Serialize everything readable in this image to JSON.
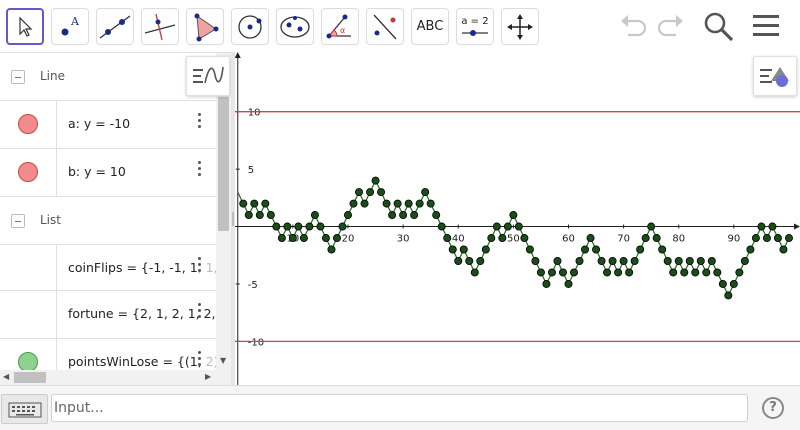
{
  "toolbar": {
    "tools": [
      {
        "name": "move-tool",
        "icon": "arrow-cursor-icon",
        "selected": true
      },
      {
        "name": "point-tool",
        "icon": "point-icon"
      },
      {
        "name": "line-tool",
        "icon": "line-icon"
      },
      {
        "name": "perpendicular-line-tool",
        "icon": "perpendicular-line-icon"
      },
      {
        "name": "polygon-tool",
        "icon": "polygon-icon"
      },
      {
        "name": "circle-center-point-tool",
        "icon": "circle-icon"
      },
      {
        "name": "conic-tool",
        "icon": "ellipse-icon"
      },
      {
        "name": "angle-tool",
        "icon": "angle-icon"
      },
      {
        "name": "reflect-tool",
        "icon": "reflect-icon"
      },
      {
        "name": "text-tool",
        "icon": "text-icon",
        "label": "ABC"
      },
      {
        "name": "slider-tool",
        "icon": "slider-icon",
        "label": "a = 2"
      },
      {
        "name": "move-graphics-view-tool",
        "icon": "move-view-icon"
      }
    ],
    "right_icons": [
      "undo-icon",
      "redo-icon",
      "search-icon",
      "menu-icon"
    ]
  },
  "algebra": {
    "groups": [
      {
        "label": "Line",
        "rows": [
          {
            "expr": "a: y = -10",
            "color": "#f28b8b",
            "visible": true
          },
          {
            "expr": "b: y = 10",
            "color": "#f28b8b",
            "visible": true
          }
        ]
      },
      {
        "label": "List",
        "rows": [
          {
            "expr": "coinFlips = {-1, -1, 1, 1,",
            "visible": false
          },
          {
            "expr": "fortune = {2, 1, 2, 1, 2, 1",
            "visible": false
          },
          {
            "expr": "pointsWinLose = {(1, 2),",
            "color": "#8fd18f",
            "visible": true
          }
        ]
      }
    ]
  },
  "input": {
    "placeholder": "Input..."
  },
  "colors": {
    "accent": "#6557d2",
    "line": "#cc4444",
    "points": "#1a4d1a",
    "segments": "#1f6b1f"
  },
  "chart_data": {
    "type": "line",
    "x_ticks": [
      10,
      20,
      30,
      40,
      50,
      60,
      70,
      80,
      90
    ],
    "y_ticks": [
      -10,
      -5,
      5,
      10
    ],
    "x_origin_label": "0",
    "xlim": [
      -0.5,
      102
    ],
    "ylim": [
      -13.8,
      15.2
    ],
    "horizontal_lines": [
      {
        "name": "a",
        "y": -10
      },
      {
        "name": "b",
        "y": 10
      }
    ],
    "series": [
      {
        "x": [
          1,
          2,
          3,
          4,
          5,
          6,
          7,
          8,
          9,
          10,
          11,
          12,
          13,
          14,
          15,
          16,
          17,
          18,
          19,
          20,
          21,
          22,
          23,
          24,
          25,
          26,
          27,
          28,
          29,
          30,
          31,
          32,
          33,
          34,
          35,
          36,
          37,
          38,
          39,
          40,
          41,
          42,
          43,
          44,
          45,
          46,
          47,
          48,
          49,
          50,
          51,
          52,
          53,
          54,
          55,
          56,
          57,
          58,
          59,
          60,
          61,
          62,
          63,
          64,
          65,
          66,
          67,
          68,
          69,
          70,
          71,
          72,
          73,
          74,
          75,
          76,
          77,
          78,
          79,
          80,
          81,
          82,
          83,
          84,
          85,
          86,
          87,
          88,
          89,
          90,
          91,
          92,
          93,
          94,
          95,
          96,
          97,
          98,
          99,
          100
        ],
        "y": [
          2,
          1,
          2,
          1,
          2,
          1,
          0,
          -1,
          0,
          -1,
          0,
          -1,
          0,
          1,
          0,
          -1,
          -2,
          -1,
          0,
          1,
          2,
          3,
          2,
          3,
          4,
          3,
          2,
          1,
          2,
          1,
          2,
          1,
          2,
          3,
          2,
          1,
          0,
          -1,
          -2,
          -3,
          -2,
          -3,
          -4,
          -3,
          -2,
          -1,
          0,
          -1,
          0,
          1,
          0,
          -1,
          -2,
          -3,
          -4,
          -5,
          -4,
          -3,
          -4,
          -5,
          -4,
          -3,
          -2,
          -1,
          -2,
          -3,
          -4,
          -3,
          -4,
          -3,
          -4,
          -3,
          -2,
          -1,
          0,
          -1,
          -2,
          -3,
          -4,
          -3,
          -4,
          -3,
          -4,
          -3,
          -4,
          -3,
          -4,
          -5,
          -6,
          -5,
          -4,
          -3,
          -2,
          -1,
          0,
          -1,
          0,
          -1,
          -2,
          -1
        ]
      }
    ]
  }
}
